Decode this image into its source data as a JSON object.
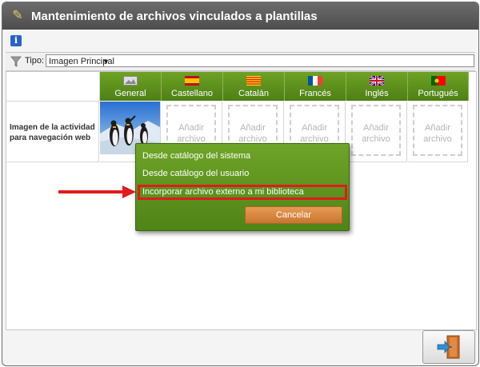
{
  "window": {
    "title": "Mantenimiento de archivos vinculados a plantillas",
    "title_icon": "pencil-icon"
  },
  "toolbar": {
    "info_glyph": "i",
    "info_icon": "info-icon"
  },
  "filter": {
    "label": "Tipo:",
    "selected": "Imagen Principal",
    "filter_icon": "funnel-icon"
  },
  "grid": {
    "columns": [
      {
        "name": "General",
        "icon": "image-icon"
      },
      {
        "name": "Castellano",
        "icon": "spain-flag-icon"
      },
      {
        "name": "Catalán",
        "icon": "catalonia-flag-icon"
      },
      {
        "name": "Francés",
        "icon": "france-flag-icon"
      },
      {
        "name": "Inglés",
        "icon": "uk-flag-icon"
      },
      {
        "name": "Portugués",
        "icon": "portugal-flag-icon"
      }
    ],
    "row": {
      "label_line1": "Imagen de la actividad",
      "label_line2": "para navegación web",
      "add_line1": "Añadir",
      "add_line2": "archivo"
    }
  },
  "popup": {
    "items": [
      "Desde catálogo del sistema",
      "Desde catálogo del usuario",
      "Incorporar archivo externo a mi biblioteca"
    ],
    "cancel_label": "Cancelar",
    "highlight_color": "#e01b1b"
  },
  "colors": {
    "header_green": "#5a8f1c",
    "accent_orange": "#d6843c"
  }
}
